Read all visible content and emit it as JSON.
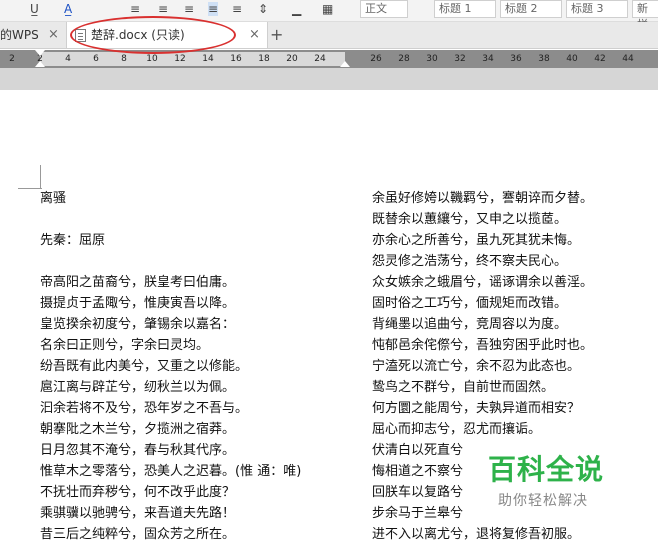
{
  "toolbar": {
    "style_normal": "正文",
    "style_h1": "标题 1",
    "style_h2": "标题 2",
    "style_h3": "标题 3",
    "style_more": "新样"
  },
  "tabs": {
    "wps_label": "的WPS",
    "active_label": "楚辞.docx (只读)",
    "close_glyph": "×",
    "add_glyph": "+"
  },
  "ruler": {
    "ticks": [
      "2",
      "2",
      "4",
      "6",
      "8",
      "10",
      "12",
      "14",
      "16",
      "18",
      "20",
      "24",
      "26",
      "28",
      "30",
      "32",
      "34",
      "36",
      "38",
      "40",
      "42",
      "44"
    ]
  },
  "document": {
    "left_column": [
      "离骚",
      "",
      "先秦：屈原",
      "",
      "帝高阳之苗裔兮，朕皇考曰伯庸。",
      "摄提贞于孟陬兮，惟庚寅吾以降。",
      "皇览揆余初度兮，肇锡余以嘉名：",
      "名余曰正则兮，字余曰灵均。",
      "纷吾既有此内美兮，又重之以修能。",
      "扈江离与辟芷兮，纫秋兰以为佩。",
      "汩余若将不及兮，恐年岁之不吾与。",
      "朝搴阰之木兰兮，夕揽洲之宿莽。",
      "日月忽其不淹兮，春与秋其代序。",
      "惟草木之零落兮，恐美人之迟暮。(惟 通：唯)",
      "不抚壮而弃秽兮，何不改乎此度？",
      "乘骐骥以驰骋兮，来吾道夫先路！",
      "昔三后之纯粹兮，固众芳之所在。"
    ],
    "right_column": [
      "余虽好修姱以鞿羁兮，謇朝谇而夕替。",
      "既替余以蕙纕兮，又申之以揽茝。",
      "亦余心之所善兮，虽九死其犹未悔。",
      "怨灵修之浩荡兮，终不察夫民心。",
      "众女嫉余之蛾眉兮，谣诼谓余以善淫。",
      "固时俗之工巧兮，偭规矩而改错。",
      "背绳墨以追曲兮，竞周容以为度。",
      "忳郁邑余侘傺兮，吾独穷困乎此时也。",
      "宁溘死以流亡兮，余不忍为此态也。",
      "鸷鸟之不群兮，自前世而固然。",
      "何方圜之能周兮，夫孰异道而相安？",
      "屈心而抑志兮，忍尤而攘诟。",
      "伏清白以死直兮",
      "悔相道之不察兮",
      "回朕车以复路兮",
      "步余马于兰皋兮",
      "进不入以离尤兮，退将复修吾初服。"
    ]
  },
  "watermark": {
    "title": "百科全说",
    "subtitle": "助你轻松解决"
  },
  "colors": {
    "annotation_ellipse": "#d9302f",
    "watermark_green": "#2eb24a"
  }
}
